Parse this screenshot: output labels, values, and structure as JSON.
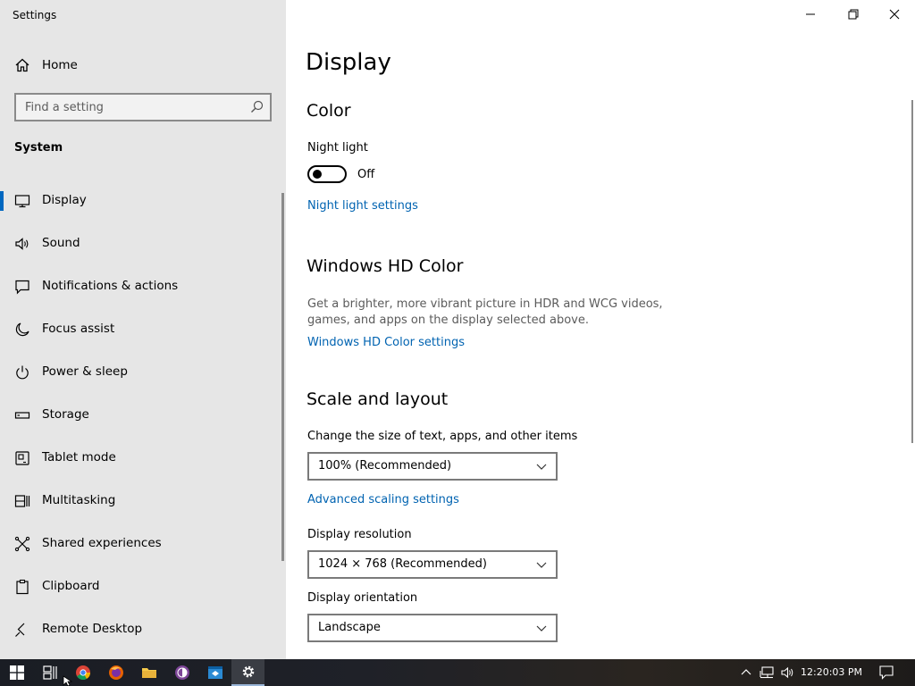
{
  "window": {
    "title": "Settings"
  },
  "sidebar": {
    "home_label": "Home",
    "search_placeholder": "Find a setting",
    "section_label": "System",
    "items": [
      {
        "label": "Display",
        "icon": "monitor-icon",
        "active": true
      },
      {
        "label": "Sound",
        "icon": "speaker-icon"
      },
      {
        "label": "Notifications & actions",
        "icon": "notification-icon"
      },
      {
        "label": "Focus assist",
        "icon": "moon-icon"
      },
      {
        "label": "Power & sleep",
        "icon": "power-icon"
      },
      {
        "label": "Storage",
        "icon": "storage-icon"
      },
      {
        "label": "Tablet mode",
        "icon": "tablet-icon"
      },
      {
        "label": "Multitasking",
        "icon": "multitasking-icon"
      },
      {
        "label": "Shared experiences",
        "icon": "shared-icon"
      },
      {
        "label": "Clipboard",
        "icon": "clipboard-icon"
      },
      {
        "label": "Remote Desktop",
        "icon": "remote-desktop-icon"
      }
    ]
  },
  "main": {
    "page_title": "Display",
    "color": {
      "heading": "Color",
      "night_light_label": "Night light",
      "night_light_state": "Off",
      "night_light_settings_link": "Night light settings"
    },
    "hd_color": {
      "heading": "Windows HD Color",
      "description": "Get a brighter, more vibrant picture in HDR and WCG videos, games, and apps on the display selected above.",
      "settings_link": "Windows HD Color settings"
    },
    "scale_layout": {
      "heading": "Scale and layout",
      "size_label": "Change the size of text, apps, and other items",
      "size_value": "100% (Recommended)",
      "advanced_link": "Advanced scaling settings",
      "resolution_label": "Display resolution",
      "resolution_value": "1024 × 768 (Recommended)",
      "orientation_label": "Display orientation",
      "orientation_value": "Landscape"
    }
  },
  "taskbar": {
    "clock": "12:20:03 PM"
  },
  "colors": {
    "accent": "#0067c0",
    "link": "#0063b1",
    "sidebar_bg": "#e6e6e6"
  }
}
